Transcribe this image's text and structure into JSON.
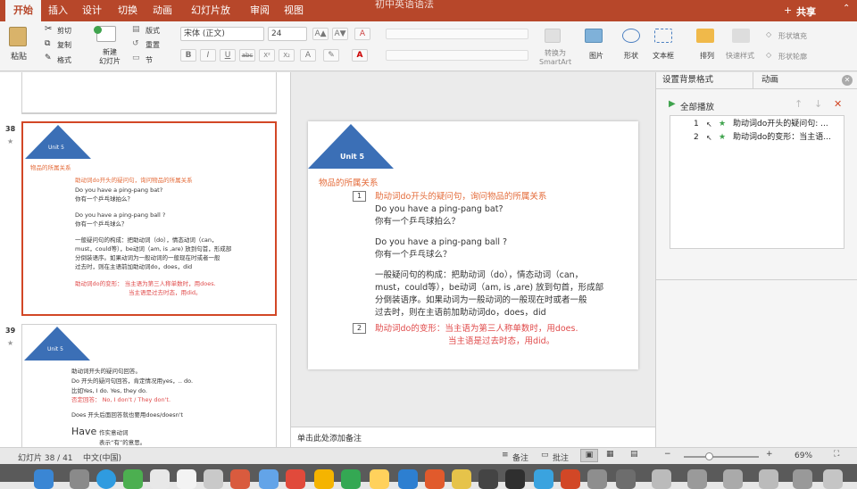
{
  "app": {
    "doc_title": "初中英语语法",
    "tabs": [
      "开始",
      "插入",
      "设计",
      "切换",
      "动画",
      "幻灯片放映",
      "审阅",
      "视图"
    ],
    "share_label": "共享"
  },
  "ribbon": {
    "paste": "粘贴",
    "cut": "剪切",
    "copy": "复制",
    "format": "格式",
    "new_slide": "新建\n幻灯片",
    "layout": "版式",
    "reset": "重置",
    "section": "节",
    "font_name": "宋体 (正文)",
    "font_size": "24",
    "bold": "B",
    "italic": "I",
    "underline": "U",
    "strike": "abc",
    "sup": "X²",
    "sub": "X₂",
    "convert_smartart": "转换为\nSmartArt",
    "picture": "图片",
    "shape": "形状",
    "textbox": "文本框",
    "arrange": "排列",
    "quick_styles": "快速样式",
    "shape_fill": "形状填充",
    "shape_outline": "形状轮廓"
  },
  "thumbs": [
    {
      "number": "38",
      "title": "Unit 5",
      "heading": "物品的所属关系",
      "lines": [
        {
          "t": "助动词do开头的疑问句，询问物品的所属关系",
          "c": "o"
        },
        {
          "t": "Do you have a ping-pang bat?",
          "c": ""
        },
        {
          "t": "你有一个乒乓球拍么？",
          "c": ""
        },
        {
          "t": "Do you have a ping-pang ball ?",
          "c": ""
        },
        {
          "t": "你有一个乒乓球么？",
          "c": ""
        },
        {
          "t": "一般疑问句的构成：把助动词（do），情态动词（can，",
          "c": ""
        },
        {
          "t": "must，could等），be动词（am, is ,are) 放到句首，形成部",
          "c": ""
        },
        {
          "t": "分倒装语序。如果动词为一般动词的一般现在时或者一般",
          "c": ""
        },
        {
          "t": "过去时，则在主语前加助动词do，does，did",
          "c": ""
        },
        {
          "t": "助动词do的变形：   当主语为第三人称单数时，用does.",
          "c": "r"
        },
        {
          "t": "当主语是过去时态，用did。",
          "c": "r"
        }
      ]
    },
    {
      "number": "39",
      "title": "Unit 5",
      "lines": [
        {
          "t": "助动词开头的疑问句回答。",
          "c": ""
        },
        {
          "t": "Do 开头的疑问句回答，肯定情况用yes，.. do.",
          "c": ""
        },
        {
          "t": "比如Yes, I do. Yes, they do.",
          "c": ""
        },
        {
          "t": "否定回答：  No, I don't / They don't.",
          "c": ""
        },
        {
          "t": "Does 开头后面回答就也要用does/doesn't",
          "c": ""
        },
        {
          "t": "Have",
          "c": ""
        },
        {
          "t": "作实意动词",
          "c": ""
        },
        {
          "t": "表示“有”的意思。",
          "c": ""
        }
      ]
    }
  ],
  "slide": {
    "title": "Unit 5",
    "heading": "物品的所属关系",
    "marker1": "1",
    "marker2": "2",
    "line1": "助动词do开头的疑问句，询问物品的所属关系",
    "line2": "Do you have a ping-pang bat?",
    "line3": "你有一个乒乓球拍么？",
    "line4": "Do you have a ping-pang ball ?",
    "line5": "你有一个乒乓球么？",
    "para1": "一般疑问句的构成：把助动词（do），情态动词（can，",
    "para2": "must，could等），be动词（am, is ,are) 放到句首，形成部",
    "para3": "分倒装语序。如果动词为一般动词的一般现在时或者一般",
    "para4": "过去时，则在主语前加助动词do，does，did",
    "red1": "助动词do的变形：当主语为第三人称单数时，用does.",
    "red2": "当主语是过去时态，用did。"
  },
  "notes_placeholder": "单击此处添加备注",
  "panel": {
    "tab_bg": "设置背景格式",
    "tab_anim": "动画",
    "play_all": "全部播放",
    "items": [
      {
        "num": "1",
        "text": "助动词do开头的疑问句: ..."
      },
      {
        "num": "2",
        "text": "助动词do的变形：当主语..."
      }
    ]
  },
  "status": {
    "slide_counter": "幻灯片 38 / 41",
    "language": "中文(中国)",
    "notes_btn": "备注",
    "comments_btn": "批注",
    "zoom": "69%"
  },
  "colors": {
    "accent": "#b7472a",
    "triangle": "#3b6fb6",
    "orange": "#e46c3b",
    "red": "#e04b4b",
    "selection": "#d24726"
  }
}
